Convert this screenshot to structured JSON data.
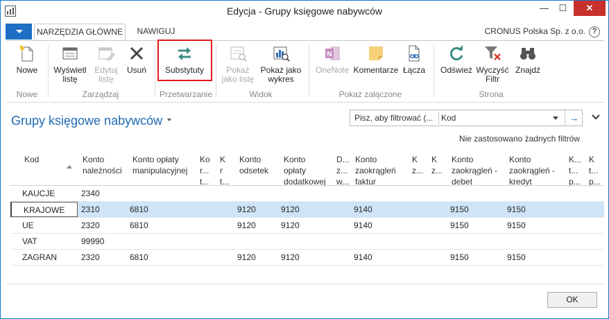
{
  "window": {
    "title": "Edycja - Grupy księgowe nabywców",
    "min_glyph": "—",
    "max_glyph": "☐",
    "close_glyph": "✕"
  },
  "tabs": {
    "home": "NARZĘDZIA GŁÓWNE",
    "navigate": "NAWIGUJ"
  },
  "company": "CRONUS Polska Sp. z o.o.",
  "help": "?",
  "ribbon": {
    "new": "Nowe",
    "show_list": "Wyświetl listę",
    "edit_list": "Edytuj listę",
    "delete": "Usuń",
    "substitutes": "Substytuty",
    "show_as_list": "Pokaż jako listę",
    "show_as_chart": "Pokaż jako wykres",
    "onenote": "OneNote",
    "comments": "Komentarze",
    "links": "Łącza",
    "refresh": "Odśwież",
    "clear_filter": "Wyczyść Filtr",
    "find": "Znajdź",
    "groups": {
      "new": "Nowe",
      "manage": "Zarządzaj",
      "process": "Przetwarzanie",
      "view": "Widok",
      "attachments": "Pokaż załączone",
      "page": "Strona"
    }
  },
  "page": {
    "title": "Grupy księgowe nabywców",
    "filter_placeholder": "Pisz, aby filtrować (...",
    "filter_field": "Kod",
    "no_filters": "Nie zastosowano żadnych filtrów"
  },
  "columns": {
    "kod": "Kod",
    "c1a": "Konto",
    "c1b": "należności",
    "c2a": "Konto opłaty",
    "c2b": "manipulacyjnej",
    "c3a": "Ko",
    "c3b": "r...",
    "c3c": "t...",
    "c4a": "K",
    "c4b": "r",
    "c4c": "t...",
    "c5a": "Konto",
    "c5b": "odsetek",
    "c6a": "Konto",
    "c6b": "opłaty",
    "c6c": "dodatkowej",
    "c7a": "D...",
    "c7b": "z...",
    "c7c": "w...",
    "c8a": "Konto",
    "c8b": "zaokrągleń",
    "c8c": "faktur",
    "c9a": "K",
    "c9b": "z...",
    "c10a": "K",
    "c10b": "z...",
    "c11a": "Konto",
    "c11b": "zaokrągleń -",
    "c11c": "debet",
    "c12a": "Konto",
    "c12b": "zaokrągleń -",
    "c12c": "kredyt",
    "c13a": "K...",
    "c13b": "t...",
    "c13c": "p...",
    "c14a": "K",
    "c14b": "t...",
    "c14c": "p..."
  },
  "rows": [
    {
      "kod": "KAUCJE",
      "naleznosci": "2340",
      "manip": "",
      "odsetek": "",
      "dodatkowej": "",
      "faktur": "",
      "debet": "",
      "kredyt": ""
    },
    {
      "kod": "KRAJOWE",
      "naleznosci": "2310",
      "manip": "6810",
      "odsetek": "9120",
      "dodatkowej": "9120",
      "faktur": "9140",
      "debet": "9150",
      "kredyt": "9150"
    },
    {
      "kod": "UE",
      "naleznosci": "2320",
      "manip": "6810",
      "odsetek": "9120",
      "dodatkowej": "9120",
      "faktur": "9140",
      "debet": "9150",
      "kredyt": "9150"
    },
    {
      "kod": "VAT",
      "naleznosci": "99990",
      "manip": "",
      "odsetek": "",
      "dodatkowej": "",
      "faktur": "",
      "debet": "",
      "kredyt": ""
    },
    {
      "kod": "ZAGRAN",
      "naleznosci": "2320",
      "manip": "6810",
      "odsetek": "9120",
      "dodatkowej": "9120",
      "faktur": "9140",
      "debet": "9150",
      "kredyt": "9150"
    }
  ],
  "footer": {
    "ok": "OK"
  }
}
